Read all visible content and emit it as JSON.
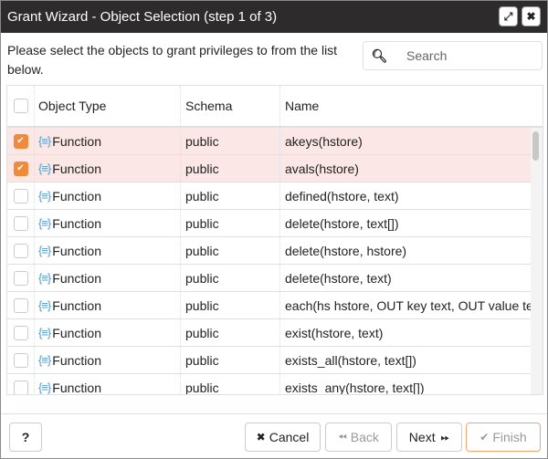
{
  "dialog": {
    "title": "Grant Wizard - Object Selection (step 1 of 3)",
    "maximize_icon": "expand-icon",
    "close_icon": "close-icon"
  },
  "intro_text": "Please select the objects to grant privileges to from the list below.",
  "search": {
    "placeholder": "Search",
    "value": "",
    "icon": "search-icon"
  },
  "grid": {
    "columns": [
      "",
      "Object Type",
      "Schema",
      "Name"
    ],
    "rows": [
      {
        "checked": true,
        "type": "Function",
        "schema": "public",
        "name": "akeys(hstore)"
      },
      {
        "checked": true,
        "type": "Function",
        "schema": "public",
        "name": "avals(hstore)"
      },
      {
        "checked": false,
        "type": "Function",
        "schema": "public",
        "name": "defined(hstore, text)"
      },
      {
        "checked": false,
        "type": "Function",
        "schema": "public",
        "name": "delete(hstore, text[])"
      },
      {
        "checked": false,
        "type": "Function",
        "schema": "public",
        "name": "delete(hstore, hstore)"
      },
      {
        "checked": false,
        "type": "Function",
        "schema": "public",
        "name": "delete(hstore, text)"
      },
      {
        "checked": false,
        "type": "Function",
        "schema": "public",
        "name": "each(hs hstore, OUT key text, OUT value text)"
      },
      {
        "checked": false,
        "type": "Function",
        "schema": "public",
        "name": "exist(hstore, text)"
      },
      {
        "checked": false,
        "type": "Function",
        "schema": "public",
        "name": "exists_all(hstore, text[])"
      },
      {
        "checked": false,
        "type": "Function",
        "schema": "public",
        "name": "exists_any(hstore, text[])"
      }
    ]
  },
  "footer": {
    "help_label": "?",
    "cancel_label": "Cancel",
    "back_label": "Back",
    "next_label": "Next",
    "finish_label": "Finish"
  },
  "colors": {
    "accent": "#f08a3c",
    "selected_row": "#fbe8e6",
    "titlebar": "#2d2b2b"
  }
}
